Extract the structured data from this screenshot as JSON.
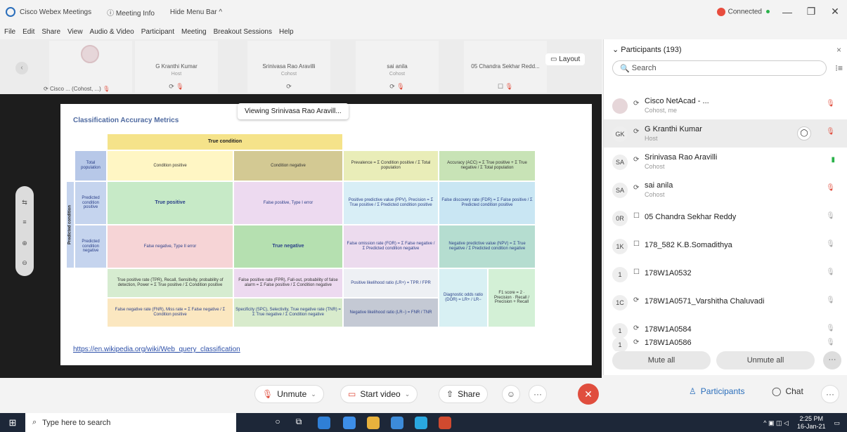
{
  "titlebar": {
    "app_title": "Cisco Webex Meetings",
    "meeting_info": "Meeting Info",
    "hide_menu_bar": "Hide Menu Bar ^",
    "connection_status": "Connected",
    "minimize": "—",
    "restore": "❐",
    "close": "✕"
  },
  "menu": [
    "File",
    "Edit",
    "Share",
    "View",
    "Audio & Video",
    "Participant",
    "Meeting",
    "Breakout Sessions",
    "Help"
  ],
  "thumbnails": [
    {
      "name": "",
      "role": "",
      "footer": "Cisco ... (Cohost, ...)"
    },
    {
      "name": "G Kranthi Kumar",
      "role": "Host"
    },
    {
      "name": "Srinivasa Rao Aravilli",
      "role": "Cohost"
    },
    {
      "name": "sai anila",
      "role": "Cohost"
    },
    {
      "name": "05 Chandra Sekhar Redd...",
      "role": ""
    }
  ],
  "layout_label": "Layout",
  "viewing_label": "Viewing Srinivasa Rao Aravill...",
  "slide": {
    "title": "Classification Accuracy Metrics",
    "link": "https://en.wikipedia.org/wiki/Web_query_classification",
    "true_condition": "True condition",
    "total_population": "Total population",
    "condition_positive": "Condition positive",
    "condition_negative": "Condition negative",
    "prevalence": "Prevalence = Σ Condition positive / Σ Total population",
    "accuracy": "Accuracy (ACC) = Σ True positive + Σ True negative / Σ Total population",
    "predicted_condition": "Predicted condition",
    "predicted_positive": "Predicted condition positive",
    "predicted_negative": "Predicted condition negative",
    "true_positive": "True positive",
    "false_positive": "False positive, Type I error",
    "ppv": "Positive predictive value (PPV), Precision = Σ True positive / Σ Predicted condition positive",
    "fdr": "False discovery rate (FDR) = Σ False positive / Σ Predicted condition positive",
    "false_negative": "False negative, Type II error",
    "true_negative": "True negative",
    "for": "False omission rate (FOR) = Σ False negative / Σ Predicted condition negative",
    "npv": "Negative predictive value (NPV) = Σ True negative / Σ Predicted condition negative",
    "tpr": "True positive rate (TPR), Recall, Sensitivity, probability of detection, Power = Σ True positive / Σ Condition positive",
    "fpr": "False positive rate (FPR), Fall-out, probability of false alarm = Σ False positive / Σ Condition negative",
    "lr_pos": "Positive likelihood ratio (LR+) = TPR / FPR",
    "dor": "Diagnostic odds ratio (DOR) = LR+ / LR−",
    "f1": "F1 score = 2 · Precision · Recall / Precision + Recall",
    "fnr": "False negative rate (FNR), Miss rate = Σ False negative / Σ Condition positive",
    "tnr": "Specificity (SPC), Selectivity, True negative rate (TNR) = Σ True negative / Σ Condition negative",
    "lr_neg": "Negative likelihood ratio (LR−) = FNR / TNR"
  },
  "panel": {
    "title": "Participants (193)",
    "search_placeholder": "Search",
    "mute_all": "Mute all",
    "unmute_all": "Unmute all",
    "participants": [
      {
        "initials": "",
        "name": "Cisco NetAcad - ...",
        "role": "Cohost, me",
        "mic": "red"
      },
      {
        "initials": "GK",
        "name": "G Kranthi Kumar",
        "role": "Host",
        "mic": "red"
      },
      {
        "initials": "SA",
        "name": "Srinivasa Rao Aravilli",
        "role": "Cohost",
        "mic": "green"
      },
      {
        "initials": "SA",
        "name": "sai anila",
        "role": "Cohost",
        "mic": "red"
      },
      {
        "initials": "0R",
        "name": "05 Chandra Sekhar Reddy",
        "role": "",
        "mic": "grey"
      },
      {
        "initials": "1K",
        "name": "178_582 K.B.Somadithya",
        "role": "",
        "mic": "grey"
      },
      {
        "initials": "1",
        "name": "178W1A0532",
        "role": "",
        "mic": "grey"
      },
      {
        "initials": "1C",
        "name": "178W1A0571_Varshitha Chaluvadi",
        "role": "",
        "mic": "grey"
      },
      {
        "initials": "1",
        "name": "178W1A0584",
        "role": "",
        "mic": "grey"
      },
      {
        "initials": "1",
        "name": "178W1A0586",
        "role": "",
        "mic": "grey"
      }
    ]
  },
  "controls": {
    "unmute": "Unmute",
    "start_video": "Start video",
    "share": "Share",
    "participants": "Participants",
    "chat": "Chat"
  },
  "taskbar": {
    "search_placeholder": "Type here to search",
    "time": "2:25 PM",
    "date": "16-Jan-21"
  }
}
